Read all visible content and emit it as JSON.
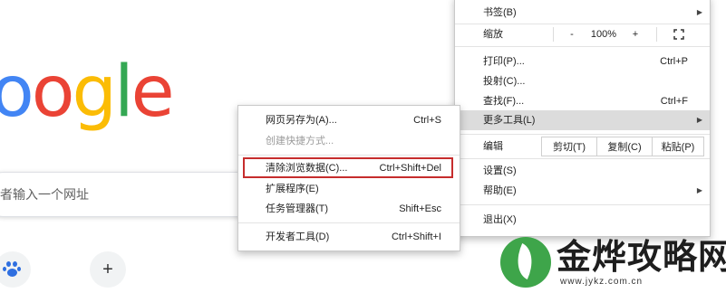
{
  "logo": {
    "text": "oogle",
    "letters": [
      {
        "ch": "o",
        "color": "#4285F4"
      },
      {
        "ch": "o",
        "color": "#EA4335"
      },
      {
        "ch": "g",
        "color": "#FBBC05"
      },
      {
        "ch": "l",
        "color": "#34A853"
      },
      {
        "ch": "e",
        "color": "#EA4335"
      }
    ]
  },
  "search": {
    "placeholder_visible": "者输入一个网址"
  },
  "shortcuts": [
    {
      "icon": "baidu-paw-icon"
    },
    {
      "icon": "plus-icon",
      "label": "+"
    }
  ],
  "menu": {
    "bookmarks": {
      "label": "书签(B)"
    },
    "zoom": {
      "label": "缩放",
      "minus": "-",
      "value": "100%",
      "plus": "+",
      "fullscreen_icon": "fullscreen-icon"
    },
    "print": {
      "label": "打印(P)...",
      "shortcut": "Ctrl+P"
    },
    "cast": {
      "label": "投射(C)..."
    },
    "find": {
      "label": "查找(F)...",
      "shortcut": "Ctrl+F"
    },
    "more_tools": {
      "label": "更多工具(L)"
    },
    "edit": {
      "label": "编辑",
      "cut": "剪切(T)",
      "copy": "复制(C)",
      "paste": "粘贴(P)"
    },
    "settings": {
      "label": "设置(S)"
    },
    "help": {
      "label": "帮助(E)"
    },
    "exit": {
      "label": "退出(X)"
    }
  },
  "submenu": {
    "save_page": {
      "label": "网页另存为(A)...",
      "shortcut": "Ctrl+S"
    },
    "create_shortcut": {
      "label": "创建快捷方式..."
    },
    "clear_data": {
      "label": "清除浏览数据(C)...",
      "shortcut": "Ctrl+Shift+Del"
    },
    "extensions": {
      "label": "扩展程序(E)"
    },
    "task_manager": {
      "label": "任务管理器(T)",
      "shortcut": "Shift+Esc"
    },
    "dev_tools": {
      "label": "开发者工具(D)",
      "shortcut": "Ctrl+Shift+I"
    }
  },
  "colors": {
    "highlight_box": "#c62d2d",
    "menu_hover": "#dcdcdc",
    "watermark_green": "#3ea54a"
  },
  "watermark": {
    "text": "金烨攻略网",
    "url": "www.jykz.com.cn"
  }
}
